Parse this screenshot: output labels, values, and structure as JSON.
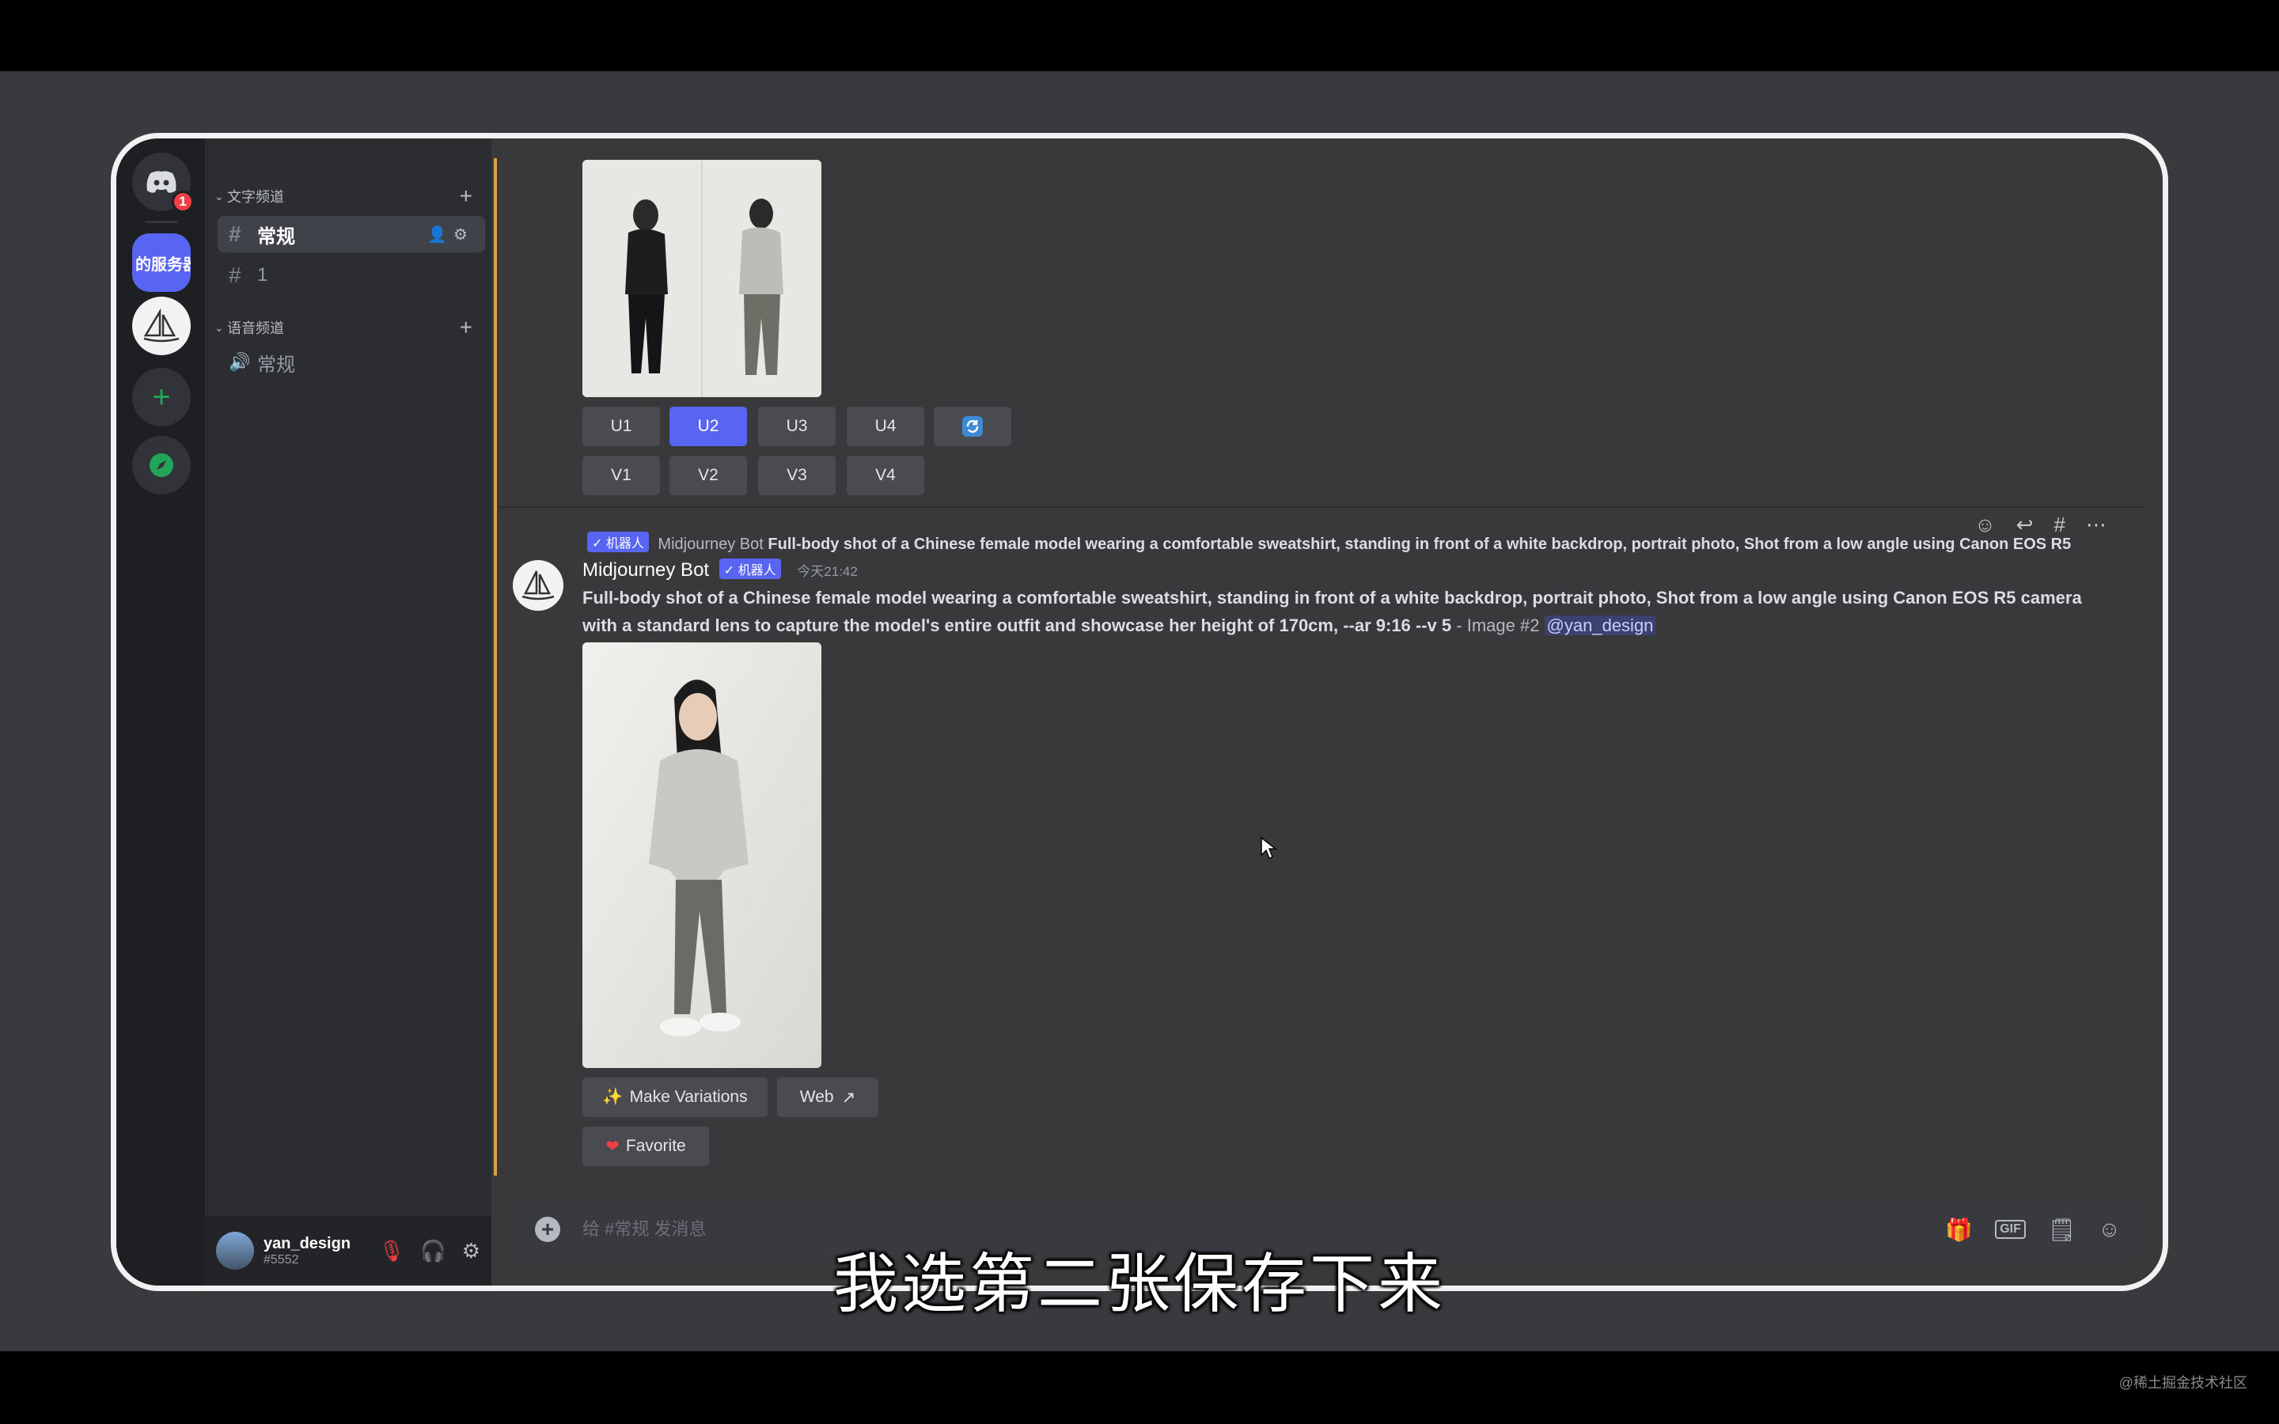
{
  "rail": {
    "home_badge": "1",
    "server_label": "的服务器"
  },
  "sidebar": {
    "text_category": "文字频道",
    "voice_category": "语音频道",
    "text_channels": [
      {
        "name": "常规"
      },
      {
        "name": "1"
      }
    ],
    "voice_channels": [
      {
        "name": "常规"
      }
    ]
  },
  "user": {
    "name": "yan_design",
    "tag": "#5552"
  },
  "grid_buttons": {
    "upscale": [
      "U1",
      "U2",
      "U3",
      "U4"
    ],
    "variation": [
      "V1",
      "V2",
      "V3",
      "V4"
    ],
    "selected": "U2"
  },
  "reply": {
    "badge": "✓ 机器人",
    "author": "Midjourney Bot",
    "text": "Full-body shot of a Chinese female model wearing a comfortable sweatshirt, standing in front of a white backdrop, portrait photo, Shot from a low angle using Canon EOS R5"
  },
  "message": {
    "author": "Midjourney Bot",
    "badge": "✓ 机器人",
    "timestamp": "今天21:42",
    "prompt": "Full-body shot of a Chinese female model wearing a comfortable sweatshirt, standing in front of a white backdrop, portrait photo, Shot from a low angle using Canon EOS R5 camera with a standard lens to capture the model's entire outfit and showcase her height of 170cm, --ar 9:16 --v 5",
    "suffix": " - Image #2 ",
    "mention": "@yan_design"
  },
  "actions": {
    "make_variations": "Make Variations",
    "web": "Web",
    "favorite": "Favorite"
  },
  "composer": {
    "placeholder": "给 #常规 发消息"
  },
  "subtitle": "我选第二张保存下来",
  "watermark": "@稀土掘金技术社区"
}
